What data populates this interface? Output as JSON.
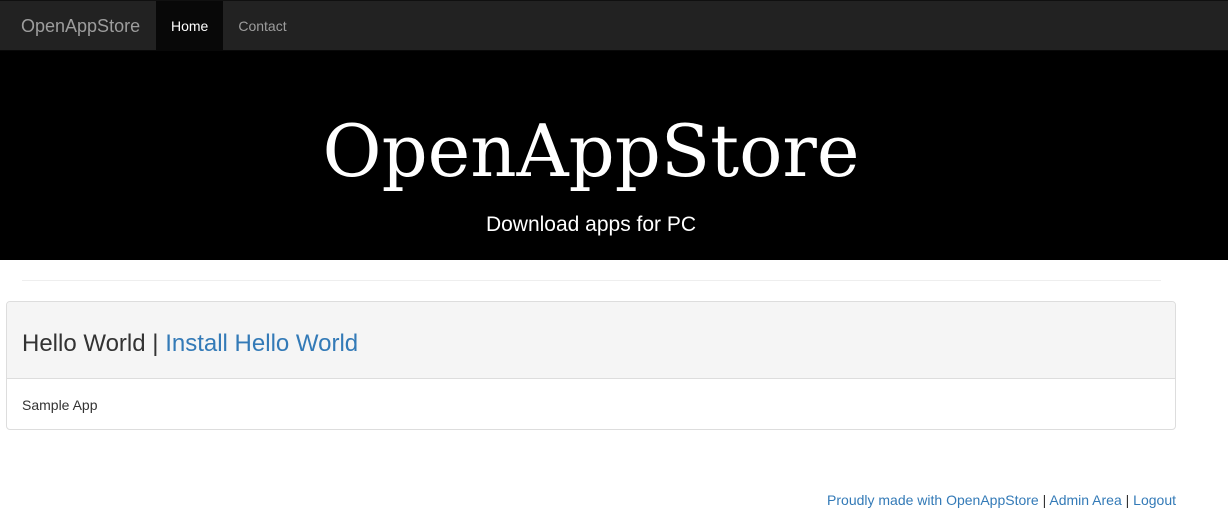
{
  "navbar": {
    "brand": "OpenAppStore",
    "items": [
      {
        "label": "Home",
        "active": true
      },
      {
        "label": "Contact",
        "active": false
      }
    ]
  },
  "hero": {
    "title": "OpenAppStore",
    "subtitle": "Download apps for PC"
  },
  "app_panel": {
    "name": "Hello World",
    "separator": " | ",
    "install_label": "Install Hello World",
    "description": "Sample App"
  },
  "footer": {
    "made_with_label": "Proudly made with OpenAppStore",
    "separator": " | ",
    "admin_label": "Admin Area",
    "logout_label": "Logout"
  },
  "colors": {
    "navbar_bg": "#222222",
    "hero_bg": "#000000",
    "link": "#337ab7",
    "panel_heading_bg": "#f5f5f5"
  }
}
